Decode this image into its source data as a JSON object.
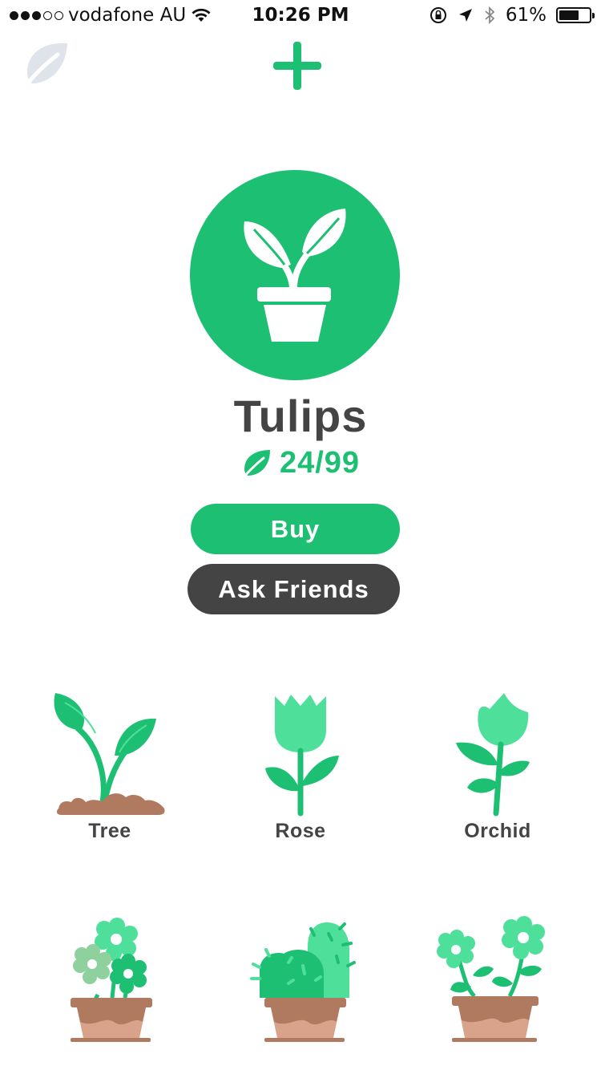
{
  "status_bar": {
    "carrier": "vodafone AU",
    "time": "10:26 PM",
    "battery": "61%",
    "battery_level": 0.61,
    "signal_bars_filled": 3,
    "signal_bars_total": 5
  },
  "top_bar": {
    "left_icon": "leaf-icon",
    "center_icon": "plus-icon"
  },
  "plant": {
    "name": "Tulips",
    "progress": "24/99",
    "icon": "potted-plant-icon"
  },
  "buttons": {
    "buy": "Buy",
    "ask_friends": "Ask Friends"
  },
  "colors": {
    "green": "#1dbf73",
    "dark": "#444444",
    "soil": "#b07a60"
  },
  "grid": [
    {
      "label": "Tree",
      "icon": "sprout-icon"
    },
    {
      "label": "Rose",
      "icon": "rose-icon"
    },
    {
      "label": "Orchid",
      "icon": "orchid-icon"
    },
    {
      "label": "",
      "icon": "flower-pot-icon"
    },
    {
      "label": "",
      "icon": "cactus-pot-icon"
    },
    {
      "label": "",
      "icon": "daisy-pot-icon"
    }
  ]
}
